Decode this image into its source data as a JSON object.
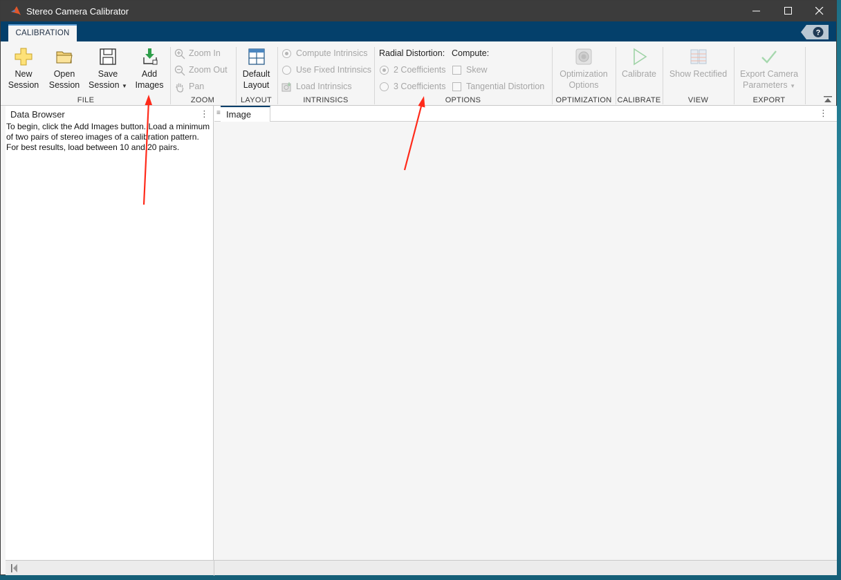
{
  "window": {
    "title": "Stereo Camera Calibrator"
  },
  "tabs": {
    "calibration": "CALIBRATION"
  },
  "toolstrip": {
    "file": {
      "label": "FILE",
      "new_session": [
        "New",
        "Session"
      ],
      "open_session": [
        "Open",
        "Session"
      ],
      "save_session": [
        "Save",
        "Session"
      ],
      "add_images": [
        "Add",
        "Images"
      ]
    },
    "zoom": {
      "label": "ZOOM",
      "zoom_in": "Zoom In",
      "zoom_out": "Zoom Out",
      "pan": "Pan"
    },
    "layout": {
      "label": "LAYOUT",
      "default_layout": [
        "Default",
        "Layout"
      ]
    },
    "intrinsics": {
      "label": "INTRINSICS",
      "compute": "Compute Intrinsics",
      "use_fixed": "Use Fixed Intrinsics",
      "load": "Load Intrinsics"
    },
    "options": {
      "label": "OPTIONS",
      "radial_label": "Radial Distortion:",
      "compute_label": "Compute:",
      "two_coeff": "2 Coefficients",
      "three_coeff": "3 Coefficients",
      "skew": "Skew",
      "tangential": "Tangential Distortion"
    },
    "optimization": {
      "label": "OPTIMIZATION",
      "options": [
        "Optimization",
        "Options"
      ]
    },
    "calibrate": {
      "label": "CALIBRATE",
      "button": "Calibrate"
    },
    "view": {
      "label": "VIEW",
      "show_rectified": "Show Rectified"
    },
    "export": {
      "label": "EXPORT",
      "button": [
        "Export Camera",
        "Parameters"
      ]
    }
  },
  "data_browser": {
    "title": "Data Browser",
    "menu": "⋮",
    "lines": [
      "To begin, click the Add Images button. Load a minimum",
      "of two pairs of stereo images of a calibration pattern.",
      "For best results, load between 10 and 20 pairs."
    ]
  },
  "image_panel": {
    "tab": "Image",
    "menu": "⋮"
  },
  "colors": {
    "accent": "#04406b",
    "arrow": "#ff2a1a"
  }
}
